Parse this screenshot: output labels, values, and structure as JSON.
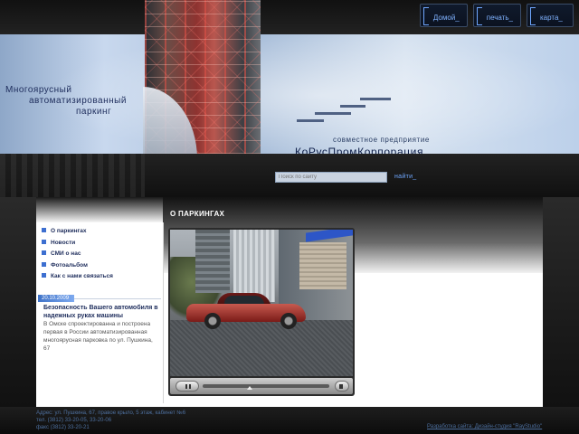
{
  "topnav": {
    "items": [
      {
        "label": "Домой_"
      },
      {
        "label": "печать_"
      },
      {
        "label": "карта_"
      }
    ]
  },
  "header": {
    "title_lines": [
      "Многоярусный",
      "автоматизированный",
      "паркинг"
    ],
    "subtitle": "совместное предприятие",
    "company": "КоРусПромКорпорация"
  },
  "search": {
    "placeholder": "Поиск по сайту",
    "button_label": "найти_"
  },
  "sidebar": {
    "items": [
      {
        "label": "О паркингах"
      },
      {
        "label": "Новости"
      },
      {
        "label": "СМИ о нас"
      },
      {
        "label": "Фотоальбом"
      },
      {
        "label": "Как с нами связаться"
      }
    ]
  },
  "news": {
    "date": "20.10.2009",
    "title": "Безопасность Вашего автомобиля в надежных руках машины",
    "text": "В Омске спроектированна и построена первая в России автоматизированная многоярусная парковка по ул. Пушкина, 67"
  },
  "main": {
    "title": "О ПАРКИНГАХ"
  },
  "player": {
    "progress": 0.37
  },
  "footer": {
    "address_lines": [
      "Адрес: ул. Пушкина, 67, правое крыло, 5 этаж, кабинет №6",
      "тел. (3812) 33-20-05, 33-20-06",
      "факс (3812) 33-20-21"
    ],
    "credits": "Разработка сайта: Дизайн-студия \"RayStudio\""
  },
  "colors": {
    "accent": "#3d6fd0",
    "nav_link": "#6fa7ff",
    "text_dark": "#1e2d5c"
  }
}
